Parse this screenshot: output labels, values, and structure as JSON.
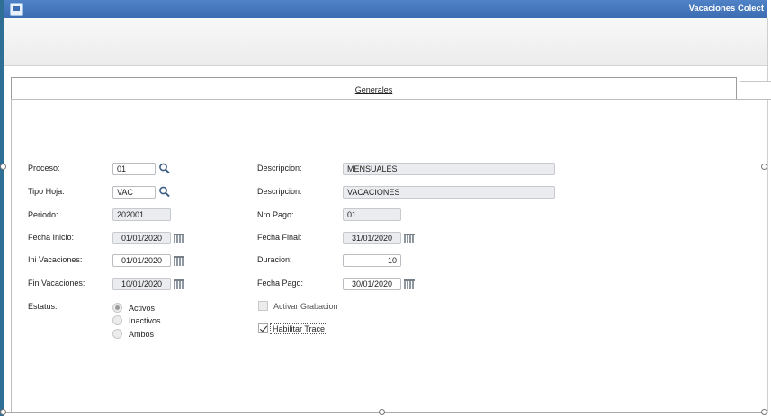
{
  "window": {
    "title": "Vacaciones Colect"
  },
  "tabs": {
    "active": "Generales"
  },
  "form": {
    "proceso": {
      "label": "Proceso:",
      "value": "01"
    },
    "tipo_hoja": {
      "label": "Tipo Hoja:",
      "value": "VAC"
    },
    "periodo": {
      "label": "Periodo:",
      "value": "202001"
    },
    "fecha_inicio": {
      "label": "Fecha Inicio:",
      "value": "01/01/2020"
    },
    "ini_vacaciones": {
      "label": "Ini Vacaciones:",
      "value": "01/01/2020"
    },
    "fin_vacaciones": {
      "label": "Fin Vacaciones:",
      "value": "10/01/2020"
    },
    "estatus": {
      "label": "Estatus:",
      "options": [
        "Activos",
        "Inactivos",
        "Ambos"
      ],
      "selected": "Activos"
    },
    "descripcion_proceso": {
      "label": "Descripcion:",
      "value": "MENSUALES"
    },
    "descripcion_tipo": {
      "label": "Descripcion:",
      "value": "VACACIONES"
    },
    "nro_pago": {
      "label": "Nro Pago:",
      "value": "01"
    },
    "fecha_final": {
      "label": "Fecha Final:",
      "value": "31/01/2020"
    },
    "duracion": {
      "label": "Duracion:",
      "value": "10"
    },
    "fecha_pago": {
      "label": "Fecha Pago:",
      "value": "30/01/2020"
    },
    "activar_grabacion": {
      "label": "Activar Grabacion",
      "checked": false,
      "enabled": false
    },
    "habilitar_trace": {
      "label": "Habilitar Trace",
      "checked": true
    }
  },
  "icons": {
    "app": "app-window-icon",
    "lookup": "magnifier-icon",
    "calendar": "calendar-grid-icon"
  },
  "colors": {
    "titlebar": "#3d6db3",
    "readonly_field": "#eaecef",
    "accent_bar": "#2f6f95"
  }
}
